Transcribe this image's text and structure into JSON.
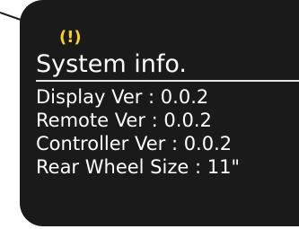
{
  "screen": {
    "warning_icon": "(!)",
    "warning_icon_name": "warning-icon",
    "warning_color": "#ffd21a",
    "title": "System info.",
    "rows": [
      "Display Ver : 0.0.2",
      "Remote Ver : 0.0.2",
      "Controller Ver : 0.0.2",
      "Rear Wheel Size : 11\""
    ]
  }
}
